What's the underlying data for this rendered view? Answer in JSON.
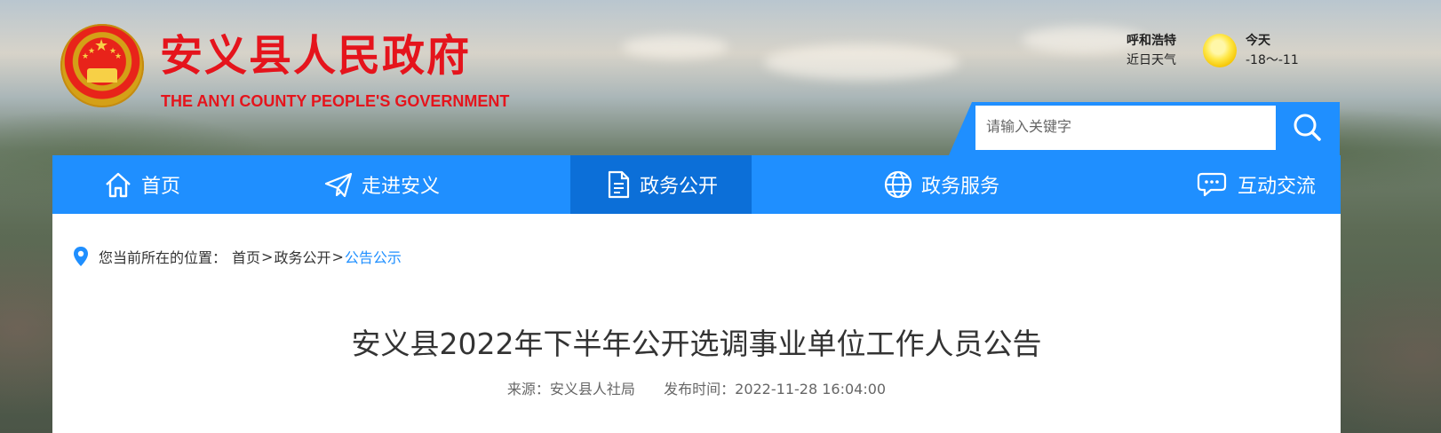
{
  "header": {
    "title": "安义县人民政府",
    "subtitle": "THE ANYI COUNTY PEOPLE'S GOVERNMENT",
    "emblem_icon": "national-emblem-icon"
  },
  "weather": {
    "city": "呼和浩特",
    "label": "近日天气",
    "icon": "sun-icon",
    "day": "今天",
    "temp": "-18～-11"
  },
  "search": {
    "placeholder": "请输入关键字",
    "icon": "search-icon"
  },
  "nav": {
    "items": [
      {
        "label": "首页",
        "icon": "home-icon"
      },
      {
        "label": "走进安义",
        "icon": "paper-plane-icon"
      },
      {
        "label": "政务公开",
        "icon": "document-icon",
        "active": true
      },
      {
        "label": "政务服务",
        "icon": "globe-icon"
      },
      {
        "label": "互动交流",
        "icon": "chat-icon"
      }
    ]
  },
  "breadcrumb": {
    "prefix": "您当前所在的位置：",
    "items": [
      "首页",
      "政务公开",
      "公告公示"
    ],
    "separator": ">"
  },
  "article": {
    "title": "安义县2022年下半年公开选调事业单位工作人员公告",
    "source_label": "来源：",
    "source": "安义县人社局",
    "time_label": "发布时间：",
    "time": "2022-11-28 16:04:00"
  },
  "colors": {
    "brand_red": "#e5141c",
    "nav_blue": "#1f8fff",
    "nav_active": "#0c6fd8",
    "link_blue": "#1f8fff"
  }
}
